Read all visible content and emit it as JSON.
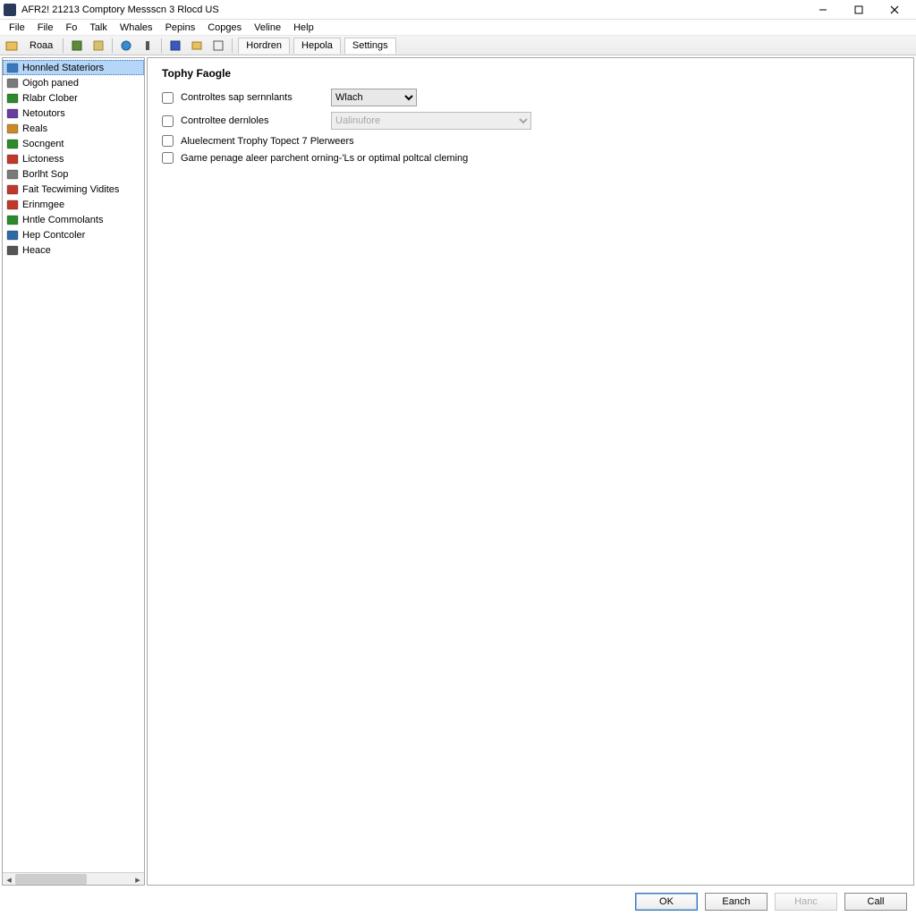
{
  "window": {
    "title": "AFR2! 21213 Comptory Messscn 3 Rlocd US"
  },
  "menus": [
    "File",
    "File",
    "Fo",
    "Talk",
    "Whales",
    "Pepins",
    "Copges",
    "Veline",
    "Help"
  ],
  "toolbar": {
    "button_label_1": "Roaa",
    "tabs": [
      "Hordren",
      "Hepola",
      "Settings"
    ],
    "active_tab_index": 2
  },
  "sidebar": {
    "items": [
      {
        "label": "Honnled Stateriors",
        "icon": "#3a78c0",
        "selected": true
      },
      {
        "label": "Oigoh paned",
        "icon": "#7a7a7a"
      },
      {
        "label": "Rlabr Clober",
        "icon": "#2d8a2d"
      },
      {
        "label": "Netoutors",
        "icon": "#6a3da0"
      },
      {
        "label": "Reals",
        "icon": "#c98a2a"
      },
      {
        "label": "Socngent",
        "icon": "#2d8a2d"
      },
      {
        "label": "Lictoness",
        "icon": "#c0392b"
      },
      {
        "label": "Borlht Sop",
        "icon": "#7a7a7a"
      },
      {
        "label": "Fait Tecwiming Vidites",
        "icon": "#c0392b"
      },
      {
        "label": "Erinmgee",
        "icon": "#c0392b"
      },
      {
        "label": "Hntle Commolants",
        "icon": "#2d8a2d"
      },
      {
        "label": "Hep Contcoler",
        "icon": "#2f6aa8"
      },
      {
        "label": "Heace",
        "icon": "#555555"
      }
    ]
  },
  "pane": {
    "title": "Tophy Faogle",
    "rows": [
      {
        "kind": "chk-label-select",
        "label": "Controltes sap sernnlants",
        "select": {
          "value": "Wlach",
          "width": "narrow"
        }
      },
      {
        "kind": "chk-label-select",
        "label": "Controltee dernloles",
        "select": {
          "value": "Ualinufore",
          "width": "wide",
          "disabled": true
        }
      },
      {
        "kind": "chk-label",
        "label": "Aluelecment Trophy Topect 7 Plerweers"
      },
      {
        "kind": "chk-label",
        "label": "Game penage aleer parchent orning-'Ls or optimal poltcal cleming"
      }
    ]
  },
  "footer": {
    "ok": "OK",
    "eanch": "Eanch",
    "hanc": "Hanc",
    "call": "Call"
  }
}
